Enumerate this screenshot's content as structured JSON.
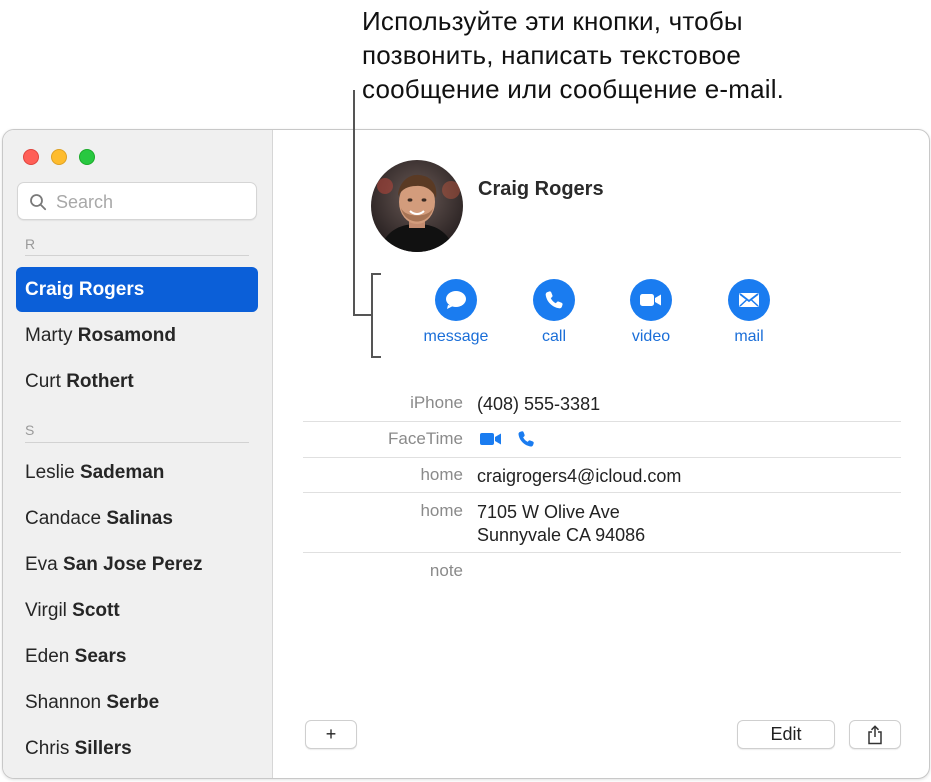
{
  "callout": {
    "lines": [
      "Используйте эти кнопки, чтобы",
      "позвонить, написать текстовое",
      "сообщение или сообщение e-mail."
    ]
  },
  "window": {
    "traffic_lights": [
      "close",
      "minimize",
      "zoom"
    ],
    "search": {
      "placeholder": "Search",
      "value": ""
    },
    "sections": [
      {
        "letter": "R",
        "contacts": [
          {
            "first": "Craig",
            "last": "Rogers",
            "selected": true
          },
          {
            "first": "Marty",
            "last": "Rosamond"
          },
          {
            "first": "Curt",
            "last": "Rothert"
          }
        ]
      },
      {
        "letter": "S",
        "contacts": [
          {
            "first": "Leslie",
            "last": "Sademan"
          },
          {
            "first": "Candace",
            "last": "Salinas"
          },
          {
            "first": "Eva",
            "last": "San Jose Perez"
          },
          {
            "first": "Virgil",
            "last": "Scott"
          },
          {
            "first": "Eden",
            "last": "Sears"
          },
          {
            "first": "Shannon",
            "last": "Serbe"
          },
          {
            "first": "Chris",
            "last": "Sillers"
          }
        ]
      }
    ],
    "detail": {
      "name": "Craig Rogers",
      "actions": [
        {
          "label": "message",
          "icon": "message-bubble-icon"
        },
        {
          "label": "call",
          "icon": "phone-icon"
        },
        {
          "label": "video",
          "icon": "video-camera-icon"
        },
        {
          "label": "mail",
          "icon": "envelope-icon"
        }
      ],
      "fields": {
        "phone": {
          "label": "iPhone",
          "value": "(408) 555-3381"
        },
        "facetime": {
          "label": "FaceTime"
        },
        "email": {
          "label": "home",
          "value": "craigrogers4@icloud.com"
        },
        "address": {
          "label": "home",
          "line1": "7105 W Olive Ave",
          "line2": "Sunnyvale CA 94086"
        },
        "note": {
          "label": "note",
          "value": ""
        }
      },
      "footer": {
        "add": "+",
        "edit": "Edit",
        "share": "share-icon"
      }
    }
  },
  "colors": {
    "accent": "#1a7cf0",
    "selection": "#0b5fd8",
    "label_blue": "#1a6ed8"
  }
}
